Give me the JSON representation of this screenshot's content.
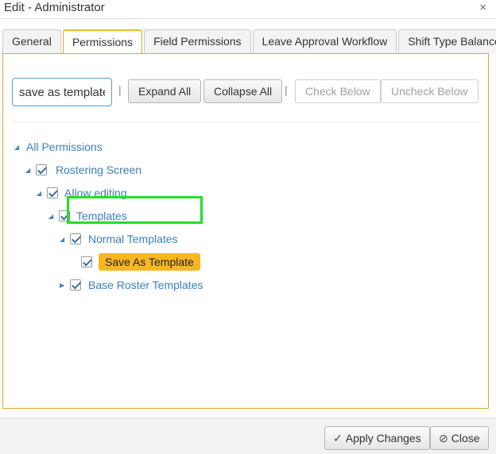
{
  "dialog": {
    "title": "Edit - Administrator",
    "close_glyph": "×"
  },
  "tabs": [
    {
      "label": "General",
      "active": false
    },
    {
      "label": "Permissions",
      "active": true
    },
    {
      "label": "Field Permissions",
      "active": false
    },
    {
      "label": "Leave Approval Workflow",
      "active": false
    },
    {
      "label": "Shift Type Balances",
      "active": false
    }
  ],
  "toolbar": {
    "search_value": "save as template",
    "separator": "|",
    "expand_all": "Expand All",
    "collapse_all": "Collapse All",
    "check_below": "Check Below",
    "uncheck_below": "Uncheck Below"
  },
  "tree": {
    "all_permissions": "All Permissions",
    "rostering_screen": "Rostering Screen",
    "allow_editing": "Allow editing",
    "templates": "Templates",
    "normal_templates": "Normal Templates",
    "save_as_template": "Save As Template",
    "base_roster_templates": "Base Roster Templates"
  },
  "footer": {
    "apply_changes": "Apply Changes",
    "close": "Close",
    "apply_icon": "check-icon",
    "close_icon": "ban-icon"
  },
  "colors": {
    "accent_border": "#e0a62a",
    "highlight": "#f8b722",
    "link": "#3a7fc1",
    "focus": "#22e022"
  }
}
